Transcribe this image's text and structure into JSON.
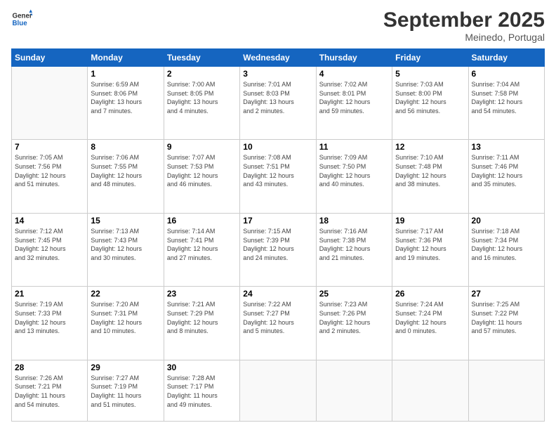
{
  "header": {
    "logo_line1": "General",
    "logo_line2": "Blue",
    "title": "September 2025",
    "subtitle": "Meinedo, Portugal"
  },
  "days_of_week": [
    "Sunday",
    "Monday",
    "Tuesday",
    "Wednesday",
    "Thursday",
    "Friday",
    "Saturday"
  ],
  "weeks": [
    [
      {
        "day": "",
        "info": ""
      },
      {
        "day": "1",
        "info": "Sunrise: 6:59 AM\nSunset: 8:06 PM\nDaylight: 13 hours\nand 7 minutes."
      },
      {
        "day": "2",
        "info": "Sunrise: 7:00 AM\nSunset: 8:05 PM\nDaylight: 13 hours\nand 4 minutes."
      },
      {
        "day": "3",
        "info": "Sunrise: 7:01 AM\nSunset: 8:03 PM\nDaylight: 13 hours\nand 2 minutes."
      },
      {
        "day": "4",
        "info": "Sunrise: 7:02 AM\nSunset: 8:01 PM\nDaylight: 12 hours\nand 59 minutes."
      },
      {
        "day": "5",
        "info": "Sunrise: 7:03 AM\nSunset: 8:00 PM\nDaylight: 12 hours\nand 56 minutes."
      },
      {
        "day": "6",
        "info": "Sunrise: 7:04 AM\nSunset: 7:58 PM\nDaylight: 12 hours\nand 54 minutes."
      }
    ],
    [
      {
        "day": "7",
        "info": "Sunrise: 7:05 AM\nSunset: 7:56 PM\nDaylight: 12 hours\nand 51 minutes."
      },
      {
        "day": "8",
        "info": "Sunrise: 7:06 AM\nSunset: 7:55 PM\nDaylight: 12 hours\nand 48 minutes."
      },
      {
        "day": "9",
        "info": "Sunrise: 7:07 AM\nSunset: 7:53 PM\nDaylight: 12 hours\nand 46 minutes."
      },
      {
        "day": "10",
        "info": "Sunrise: 7:08 AM\nSunset: 7:51 PM\nDaylight: 12 hours\nand 43 minutes."
      },
      {
        "day": "11",
        "info": "Sunrise: 7:09 AM\nSunset: 7:50 PM\nDaylight: 12 hours\nand 40 minutes."
      },
      {
        "day": "12",
        "info": "Sunrise: 7:10 AM\nSunset: 7:48 PM\nDaylight: 12 hours\nand 38 minutes."
      },
      {
        "day": "13",
        "info": "Sunrise: 7:11 AM\nSunset: 7:46 PM\nDaylight: 12 hours\nand 35 minutes."
      }
    ],
    [
      {
        "day": "14",
        "info": "Sunrise: 7:12 AM\nSunset: 7:45 PM\nDaylight: 12 hours\nand 32 minutes."
      },
      {
        "day": "15",
        "info": "Sunrise: 7:13 AM\nSunset: 7:43 PM\nDaylight: 12 hours\nand 30 minutes."
      },
      {
        "day": "16",
        "info": "Sunrise: 7:14 AM\nSunset: 7:41 PM\nDaylight: 12 hours\nand 27 minutes."
      },
      {
        "day": "17",
        "info": "Sunrise: 7:15 AM\nSunset: 7:39 PM\nDaylight: 12 hours\nand 24 minutes."
      },
      {
        "day": "18",
        "info": "Sunrise: 7:16 AM\nSunset: 7:38 PM\nDaylight: 12 hours\nand 21 minutes."
      },
      {
        "day": "19",
        "info": "Sunrise: 7:17 AM\nSunset: 7:36 PM\nDaylight: 12 hours\nand 19 minutes."
      },
      {
        "day": "20",
        "info": "Sunrise: 7:18 AM\nSunset: 7:34 PM\nDaylight: 12 hours\nand 16 minutes."
      }
    ],
    [
      {
        "day": "21",
        "info": "Sunrise: 7:19 AM\nSunset: 7:33 PM\nDaylight: 12 hours\nand 13 minutes."
      },
      {
        "day": "22",
        "info": "Sunrise: 7:20 AM\nSunset: 7:31 PM\nDaylight: 12 hours\nand 10 minutes."
      },
      {
        "day": "23",
        "info": "Sunrise: 7:21 AM\nSunset: 7:29 PM\nDaylight: 12 hours\nand 8 minutes."
      },
      {
        "day": "24",
        "info": "Sunrise: 7:22 AM\nSunset: 7:27 PM\nDaylight: 12 hours\nand 5 minutes."
      },
      {
        "day": "25",
        "info": "Sunrise: 7:23 AM\nSunset: 7:26 PM\nDaylight: 12 hours\nand 2 minutes."
      },
      {
        "day": "26",
        "info": "Sunrise: 7:24 AM\nSunset: 7:24 PM\nDaylight: 12 hours\nand 0 minutes."
      },
      {
        "day": "27",
        "info": "Sunrise: 7:25 AM\nSunset: 7:22 PM\nDaylight: 11 hours\nand 57 minutes."
      }
    ],
    [
      {
        "day": "28",
        "info": "Sunrise: 7:26 AM\nSunset: 7:21 PM\nDaylight: 11 hours\nand 54 minutes."
      },
      {
        "day": "29",
        "info": "Sunrise: 7:27 AM\nSunset: 7:19 PM\nDaylight: 11 hours\nand 51 minutes."
      },
      {
        "day": "30",
        "info": "Sunrise: 7:28 AM\nSunset: 7:17 PM\nDaylight: 11 hours\nand 49 minutes."
      },
      {
        "day": "",
        "info": ""
      },
      {
        "day": "",
        "info": ""
      },
      {
        "day": "",
        "info": ""
      },
      {
        "day": "",
        "info": ""
      }
    ]
  ]
}
